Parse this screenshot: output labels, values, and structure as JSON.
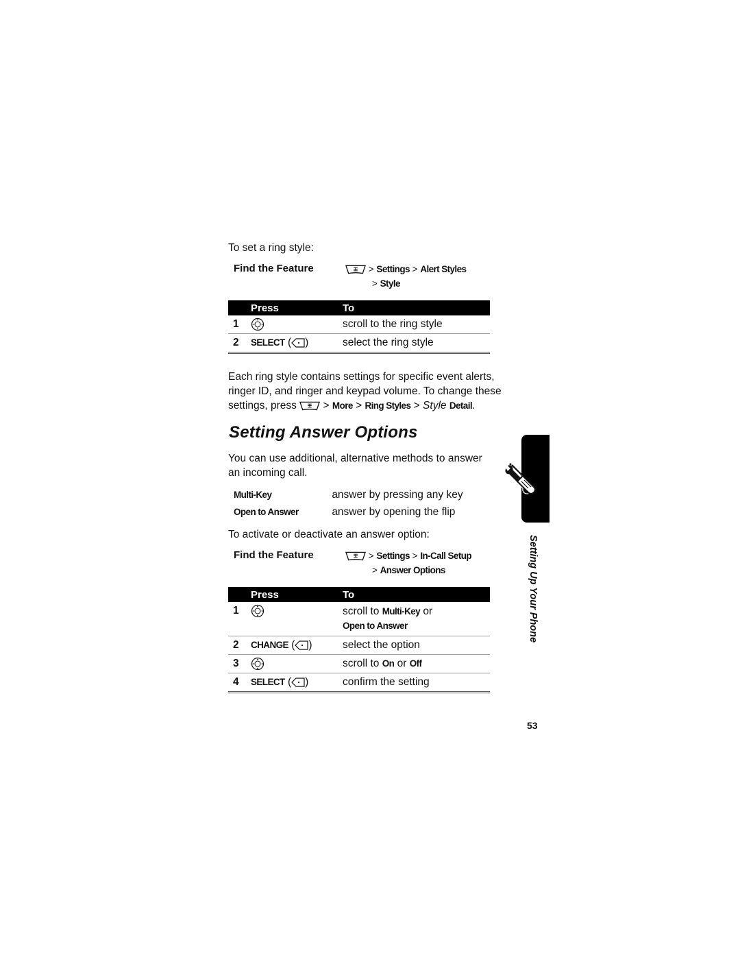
{
  "section1": {
    "intro": "To set a ring style:",
    "find_feature": {
      "label": "Find the Feature",
      "menu_icon": "menu-key-icon",
      "path_line1": [
        "Settings",
        "Alert Styles"
      ],
      "path_line2": [
        "Style"
      ],
      "sep": ">"
    },
    "table": {
      "headers": [
        "Press",
        "To"
      ],
      "rows": [
        {
          "num": "1",
          "press_icon": "nav-key-icon",
          "press_label": "",
          "to": "scroll to the ring style"
        },
        {
          "num": "2",
          "press_icon": "select-softkey-icon",
          "press_label": "SELECT",
          "to": "select the ring style"
        }
      ]
    },
    "paragraph": {
      "line1": "Each ring style contains settings for specific event alerts,",
      "line2": "ringer ID, and ringer and keypad volume. To change these",
      "line3_prefix": "settings, press",
      "path": [
        "More",
        "Ring Styles"
      ],
      "style_italic": "Style",
      "detail": "Detail",
      "end": "."
    }
  },
  "section2": {
    "heading": "Setting Answer Options",
    "intro_line1": "You can use additional, alternative methods to answer",
    "intro_line2": "an incoming call.",
    "options": [
      {
        "name": "Multi-Key",
        "desc": "answer by pressing any key"
      },
      {
        "name": "Open to Answer",
        "desc": "answer by opening the flip"
      }
    ],
    "activate_text": "To activate or deactivate an answer option:",
    "find_feature": {
      "label": "Find the Feature",
      "menu_icon": "menu-key-icon",
      "path_line1": [
        "Settings",
        "In-Call Setup"
      ],
      "path_line2": [
        "Answer Options"
      ],
      "sep": ">"
    },
    "table": {
      "headers": [
        "Press",
        "To"
      ],
      "rows": [
        {
          "num": "1",
          "press_icon": "nav-key-icon",
          "press_label": "",
          "to_prefix": "scroll to",
          "to_bold1": "Multi-Key",
          "to_mid": "or",
          "to_bold2": "Open to Answer"
        },
        {
          "num": "2",
          "press_icon": "select-softkey-icon",
          "press_label": "CHANGE",
          "to": "select the option"
        },
        {
          "num": "3",
          "press_icon": "nav-key-icon",
          "press_label": "",
          "to_prefix": "scroll to",
          "to_bold1": "On",
          "to_mid": "or",
          "to_bold2": "Off"
        },
        {
          "num": "4",
          "press_icon": "select-softkey-icon",
          "press_label": "SELECT",
          "to": "confirm the setting"
        }
      ]
    }
  },
  "side_tab": {
    "icon": "wrench-screwdriver-icon",
    "label": "Setting Up Your Phone"
  },
  "page_number": "53"
}
